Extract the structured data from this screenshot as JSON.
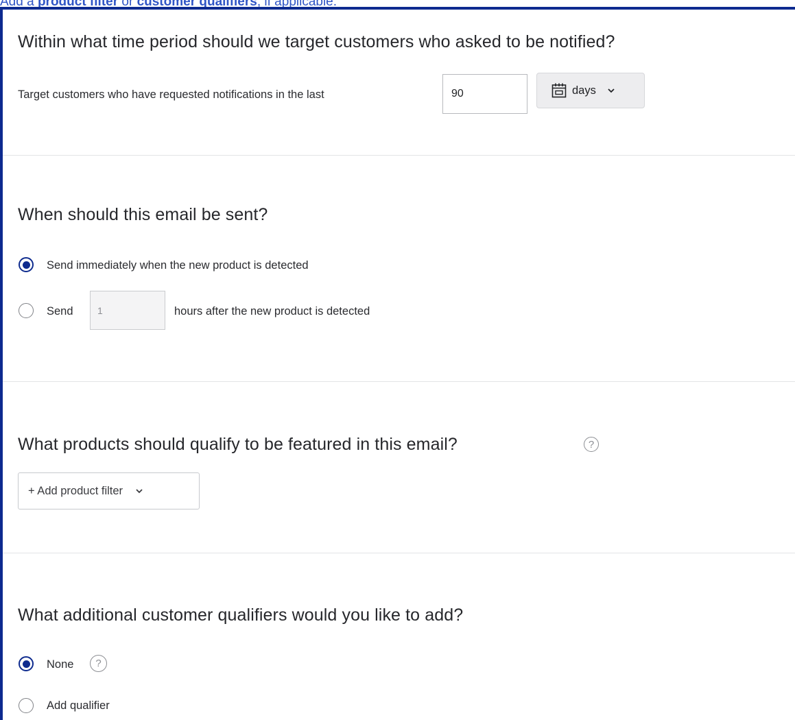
{
  "intro": {
    "prefix": "Add a ",
    "bold1": "product filter",
    "middle": " or ",
    "bold2": "customer qualifiers",
    "suffix": ", if applicable."
  },
  "time_period": {
    "heading": "Within what time period should we target customers who asked to be notified?",
    "label": "Target customers who have requested notifications in the last",
    "value": "90",
    "unit_selected": "days"
  },
  "send_timing": {
    "heading": "When should this email be sent?",
    "option_immediate": "Send immediately when the new product is detected",
    "option_delay_prefix": "Send",
    "delay_value": "1",
    "option_delay_suffix": "hours after the new product is detected",
    "selected": "immediate"
  },
  "products": {
    "heading": "What products should qualify to be featured in this email?",
    "help": "?",
    "add_filter_label": "+ Add product filter"
  },
  "qualifiers": {
    "heading": "What additional customer qualifiers would you like to add?",
    "option_none": "None",
    "option_add": "Add qualifier",
    "help": "?",
    "selected": "none"
  },
  "colors": {
    "accent": "#0e2b8e",
    "intro_text": "#2f55c6"
  },
  "icons": {
    "calendar": "calendar-icon",
    "chevron": "chevron-down-icon",
    "help": "question-circle-icon"
  }
}
